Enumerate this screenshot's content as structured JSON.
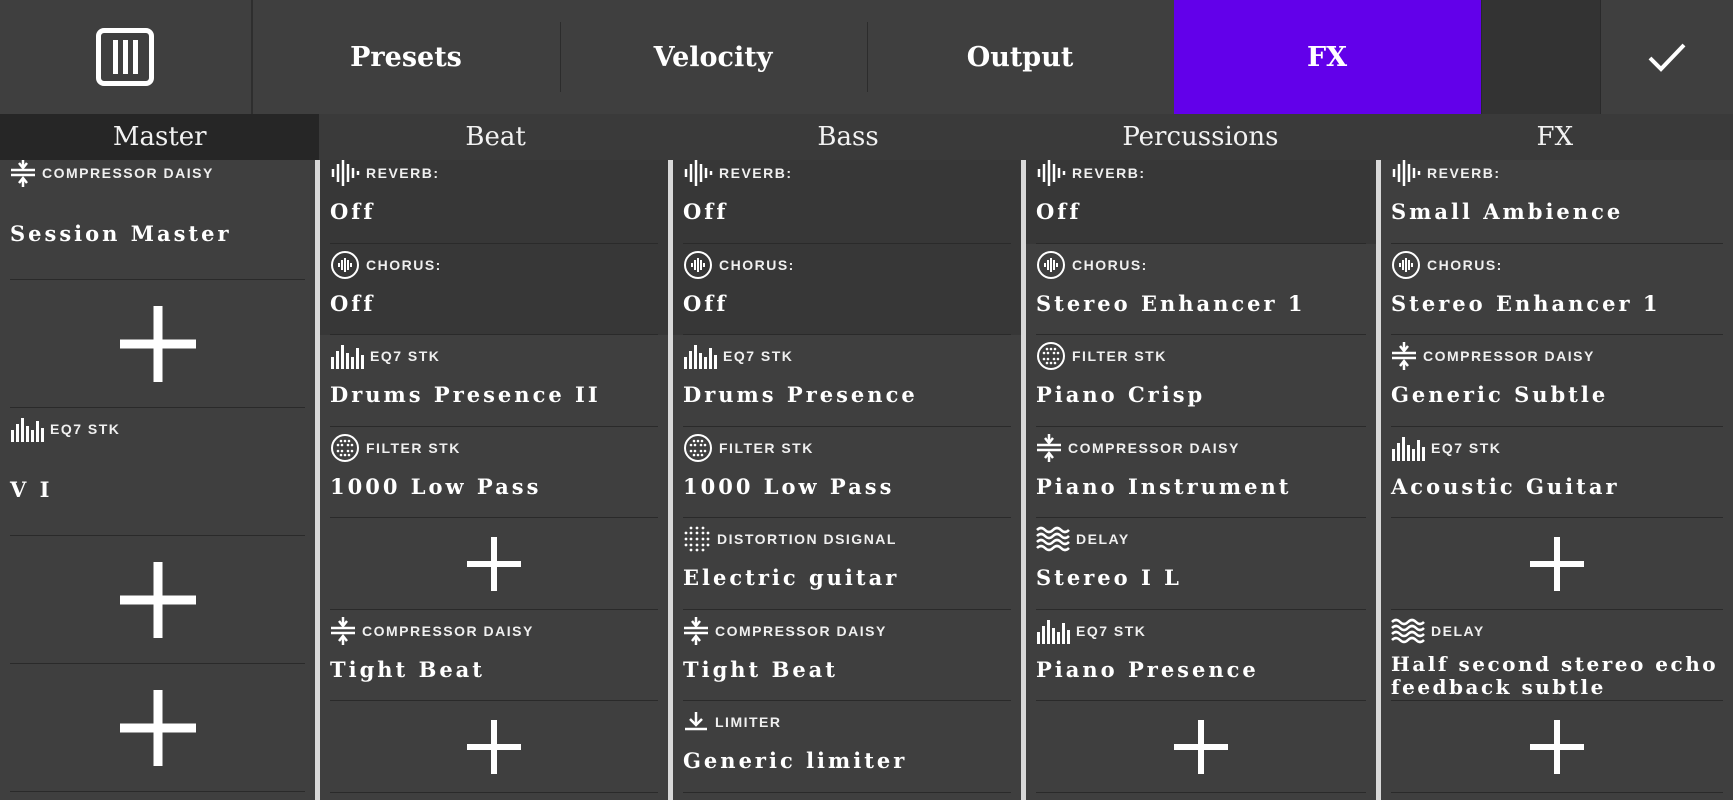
{
  "tabs": [
    {
      "label": "Presets",
      "active": false
    },
    {
      "label": "Velocity",
      "active": false
    },
    {
      "label": "Output",
      "active": false
    },
    {
      "label": "FX",
      "active": true
    }
  ],
  "colors": {
    "accent": "#6200ea",
    "background": "#3f3f3f",
    "divider": "#d8d8d8"
  },
  "icons": {
    "menu": "piano-keys-icon",
    "confirm": "checkmark-icon",
    "add": "plus-icon"
  },
  "channels": [
    {
      "name": "Master",
      "slots": [
        {
          "type": "COMPRESSOR DAISY",
          "icon": "compressor-icon",
          "name": "Session Master"
        },
        {
          "add": true
        },
        {
          "type": "EQ7 STK",
          "icon": "eq-icon",
          "name": "V I"
        },
        {
          "add": true
        },
        {
          "add": true
        }
      ]
    },
    {
      "name": "Beat",
      "slots": [
        {
          "type": "REVERB:",
          "icon": "reverb-icon",
          "name": "Off"
        },
        {
          "type": "CHORUS:",
          "icon": "chorus-icon",
          "name": "Off"
        },
        {
          "type": "EQ7 STK",
          "icon": "eq-icon",
          "name": "Drums Presence II"
        },
        {
          "type": "FILTER STK",
          "icon": "filter-icon",
          "name": "1000 Low Pass"
        },
        {
          "add": true
        },
        {
          "type": "COMPRESSOR DAISY",
          "icon": "compressor-icon",
          "name": "Tight Beat"
        },
        {
          "add": true
        }
      ]
    },
    {
      "name": "Bass",
      "slots": [
        {
          "type": "REVERB:",
          "icon": "reverb-icon",
          "name": "Off"
        },
        {
          "type": "CHORUS:",
          "icon": "chorus-icon",
          "name": "Off"
        },
        {
          "type": "EQ7 STK",
          "icon": "eq-icon",
          "name": "Drums Presence"
        },
        {
          "type": "FILTER STK",
          "icon": "filter-icon",
          "name": "1000 Low Pass"
        },
        {
          "type": "DISTORTION DSIGNAL",
          "icon": "distortion-icon",
          "name": "Electric guitar"
        },
        {
          "type": "COMPRESSOR DAISY",
          "icon": "compressor-icon",
          "name": "Tight Beat"
        },
        {
          "type": "LIMITER",
          "icon": "limiter-icon",
          "name": "Generic limiter"
        }
      ]
    },
    {
      "name": "Percussions",
      "slots": [
        {
          "type": "REVERB:",
          "icon": "reverb-icon",
          "name": "Off"
        },
        {
          "type": "CHORUS:",
          "icon": "chorus-icon",
          "name": "Stereo Enhancer 1"
        },
        {
          "type": "FILTER STK",
          "icon": "filter-icon",
          "name": "Piano Crisp"
        },
        {
          "type": "COMPRESSOR DAISY",
          "icon": "compressor-icon",
          "name": "Piano Instrument"
        },
        {
          "type": "DELAY",
          "icon": "delay-icon",
          "name": "Stereo I L"
        },
        {
          "type": "EQ7 STK",
          "icon": "eq-icon",
          "name": "Piano Presence"
        },
        {
          "add": true
        }
      ]
    },
    {
      "name": "FX",
      "slots": [
        {
          "type": "REVERB:",
          "icon": "reverb-icon",
          "name": "Small Ambience"
        },
        {
          "type": "CHORUS:",
          "icon": "chorus-icon",
          "name": "Stereo Enhancer 1"
        },
        {
          "type": "COMPRESSOR DAISY",
          "icon": "compressor-icon",
          "name": "Generic Subtle"
        },
        {
          "type": "EQ7 STK",
          "icon": "eq-icon",
          "name": "Acoustic Guitar"
        },
        {
          "add": true
        },
        {
          "type": "DELAY",
          "icon": "delay-icon",
          "name": "Half second stereo echo feedback subtle"
        },
        {
          "add": true
        }
      ]
    }
  ]
}
